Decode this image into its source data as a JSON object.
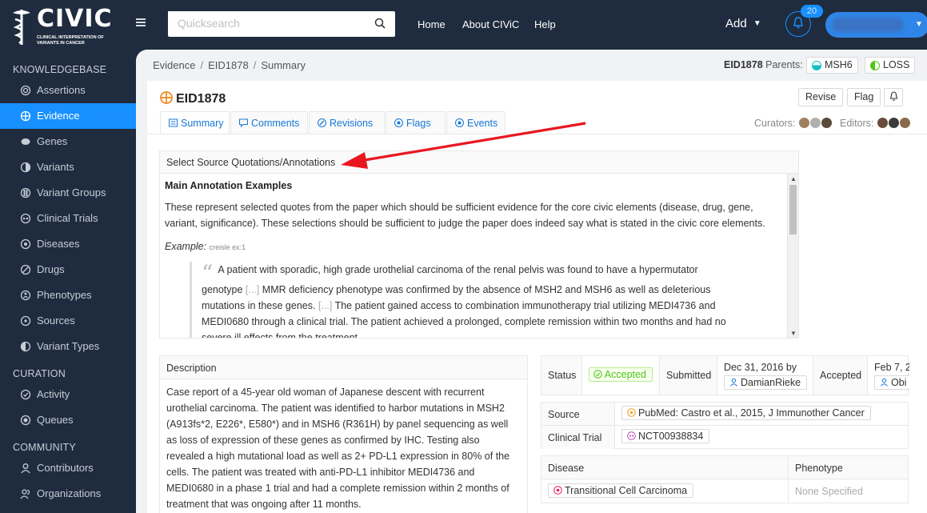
{
  "brand": {
    "name": "CIVIC",
    "tagline": "Clinical Interpretation of Variants in Cancer"
  },
  "search": {
    "placeholder": "Quicksearch"
  },
  "topnav": {
    "home": "Home",
    "about": "About CIViC",
    "help": "Help",
    "add": "Add",
    "notification_count": "20"
  },
  "sidebar": {
    "knowledgebase_heading": "KNOWLEDGEBASE",
    "knowledgebase": [
      {
        "label": "Assertions",
        "icon": "assertion-icon"
      },
      {
        "label": "Evidence",
        "icon": "evidence-icon",
        "active": true
      },
      {
        "label": "Genes",
        "icon": "gene-icon"
      },
      {
        "label": "Variants",
        "icon": "variant-icon"
      },
      {
        "label": "Variant Groups",
        "icon": "variant-group-icon"
      },
      {
        "label": "Clinical Trials",
        "icon": "clinical-trial-icon"
      },
      {
        "label": "Diseases",
        "icon": "disease-icon"
      },
      {
        "label": "Drugs",
        "icon": "drug-icon"
      },
      {
        "label": "Phenotypes",
        "icon": "phenotype-icon"
      },
      {
        "label": "Sources",
        "icon": "source-icon"
      },
      {
        "label": "Variant Types",
        "icon": "variant-type-icon"
      }
    ],
    "curation_heading": "CURATION",
    "curation": [
      {
        "label": "Activity",
        "icon": "activity-icon"
      },
      {
        "label": "Queues",
        "icon": "queue-icon"
      }
    ],
    "community_heading": "COMMUNITY",
    "community": [
      {
        "label": "Contributors",
        "icon": "contributor-icon"
      },
      {
        "label": "Organizations",
        "icon": "organization-icon"
      }
    ]
  },
  "breadcrumb": [
    "Evidence",
    "EID1878",
    "Summary"
  ],
  "parents": {
    "eid": "EID1878",
    "label": "Parents:",
    "items": [
      "MSH6",
      "LOSS"
    ]
  },
  "evidence": {
    "title": "EID1878",
    "actions": {
      "revise": "Revise",
      "flag": "Flag"
    },
    "tabs": [
      "Summary",
      "Comments",
      "Revisions",
      "Flags",
      "Events"
    ],
    "curators_label": "Curators:",
    "editors_label": "Editors:"
  },
  "annotation": {
    "header": "Select Source Quotations/Annotations",
    "heading": "Main Annotation Examples",
    "intro": "These represent selected quotes from the paper which should be sufficient evidence for the core civic elements (disease, drug, gene, variant, significance). These selections should be sufficient to judge the paper does indeed say what is stated in the civic core elements.",
    "example_label": "Example:",
    "example_ref": "creisle ex:1",
    "quote_part1": "A patient with sporadic, high grade urothelial carcinoma of the renal pelvis was found to have a hypermutator genotype",
    "quote_part2": "MMR deficiency phenotype was confirmed by the absence of MSH2 and MSH6 as well as deleterious mutations in these genes.",
    "quote_part3": "The patient gained access to combination immunotherapy trial utilizing MEDI4736 and MEDI0680 through a clinical trial. The patient achieved a prolonged, complete remission within two months and had no severe ill effects from the treatment.",
    "ellipsis": "[...]"
  },
  "description": {
    "header": "Description",
    "text": "Case report of a 45-year old woman of Japanese descent with recurrent urothelial carcinoma. The patient was identified to harbor mutations in MSH2 (A913fs*2, E226*, E580*) and in MSH6 (R361H) by panel sequencing as well as loss of expression of these genes as confirmed by IHC. Testing also revealed a high mutational load as well as 2+ PD-L1 expression in 80% of the cells. The patient was treated with anti-PD-L1 inhibitor MEDI4736 and MEDI0680 in a phase 1 trial and had a complete remission within 2 months of treatment that was ongoing after 11 months."
  },
  "status_row": {
    "status_label": "Status",
    "status_value": "Accepted",
    "submitted_label": "Submitted",
    "submitted_date": "Dec 31, 2016 by",
    "submitted_by": "DamianRieke",
    "accepted_label": "Accepted",
    "accepted_date": "Feb 7, 2",
    "accepted_by": "Obi"
  },
  "source_table": {
    "source_label": "Source",
    "source_value": "PubMed: Castro et al., 2015, J Immunother Cancer",
    "trial_label": "Clinical Trial",
    "trial_value": "NCT00938834"
  },
  "disease_table": {
    "disease_label": "Disease",
    "phenotype_label": "Phenotype",
    "disease_value": "Transitional Cell Carcinoma",
    "phenotype_value": "None Specified"
  },
  "colors": {
    "accent": "#1890ff",
    "nav_bg": "#1f2c3f",
    "annotation_arrow": "#e8171f",
    "accepted_green": "#52c41a"
  }
}
